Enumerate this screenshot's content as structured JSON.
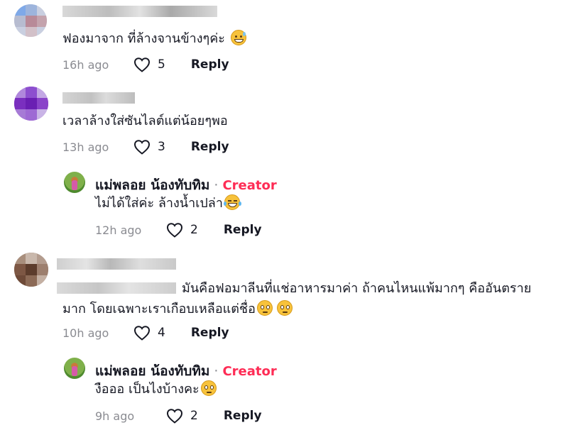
{
  "comments": [
    {
      "text": "ฟองมาจาก ที่ล้างจานข้างๆค่ะ",
      "emoji": "grinning-sweat-emoji",
      "time": "16h ago",
      "likes": "5",
      "reply": "Reply"
    },
    {
      "text": "เวลาล้างใส่ซันไลต์แต่น้อยๆพอ",
      "time": "13h ago",
      "likes": "3",
      "reply": "Reply",
      "creator_reply": {
        "name": "แม่พลอย น้องทับทิม",
        "separator": "·",
        "badge": "Creator",
        "text": "ไม่ได้ใส่ค่ะ ล้างน้ำเปล่า",
        "emoji": "tears-of-joy-emoji",
        "time": "12h ago",
        "likes": "2",
        "reply": "Reply"
      }
    },
    {
      "text_line1": "มันคือฟอมาลีนที่แช่อาหารมาค่า ถ้าคนไหนแพ้มากๆ คืออันตราย",
      "text_line2": "มาก โดยเฉพาะเราเกือบเหลือแต่ชื่อ",
      "emoji": "pleading-face-emoji",
      "time": "10h ago",
      "likes": "4",
      "reply": "Reply",
      "creator_reply": {
        "name": "แม่พลอย น้องทับทิม",
        "separator": "·",
        "badge": "Creator",
        "text": "งือออ เป็นไงบ้างคะ",
        "emoji": "pleading-face-emoji",
        "time": "9h ago",
        "likes": "2",
        "reply": "Reply"
      }
    }
  ],
  "colors": {
    "creator_badge": "#fe2c55",
    "meta_gray": "#8a8b91",
    "text": "#161823"
  }
}
